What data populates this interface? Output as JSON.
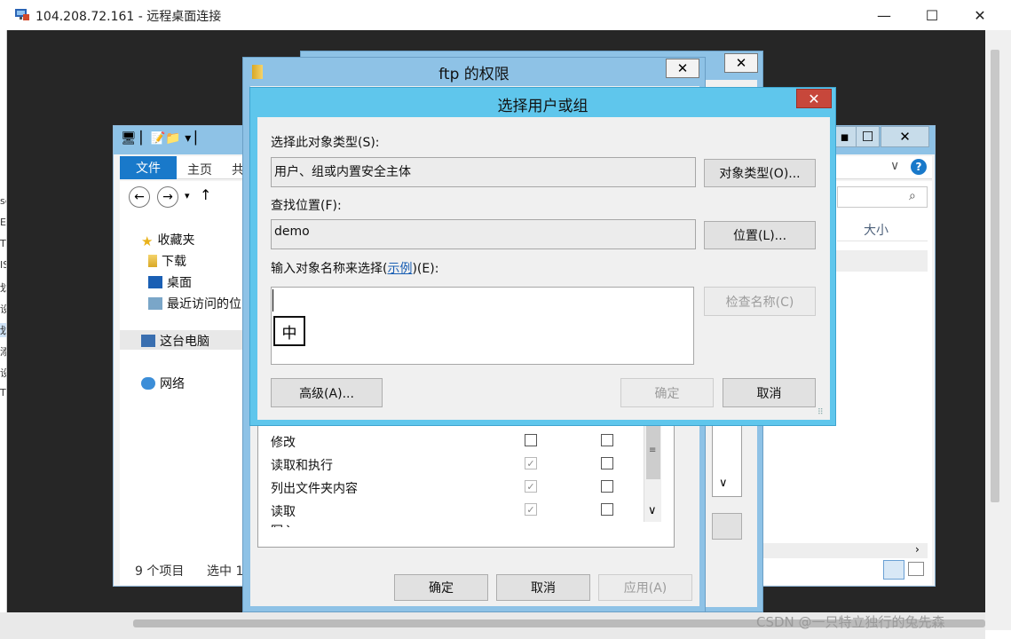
{
  "host": {
    "title": "104.208.72.161 - 远程桌面连接",
    "controls": [
      "—",
      "☐",
      "✕"
    ],
    "left_strip_chars": [
      "se",
      "E",
      "T",
      "IS",
      "划",
      "设",
      "划",
      "添",
      "设",
      "T"
    ],
    "watermark": "CSDN @一只特立独行的兔先森"
  },
  "explorer": {
    "ribbon_tabs": [
      "文件",
      "主页",
      "共"
    ],
    "nav_buttons": [
      "←",
      "→",
      "▾",
      "↑"
    ],
    "nav_items": [
      {
        "label": "收藏夹",
        "icon": "star-icon"
      },
      {
        "label": "下载",
        "icon": "download-folder-icon"
      },
      {
        "label": "桌面",
        "icon": "desktop-icon"
      },
      {
        "label": "最近访问的位",
        "icon": "recent-places-icon"
      },
      {
        "label": "这台电脑",
        "icon": "computer-icon"
      },
      {
        "label": "网络",
        "icon": "network-icon"
      }
    ],
    "column_size": "大小",
    "search_icon": "⌕",
    "help_icon": "?",
    "chevron": "∨",
    "status_count": "9 个项目",
    "status_selected": "选中 1",
    "window_controls": [
      "▪",
      "☐",
      "✕"
    ]
  },
  "ftp_dialog": {
    "title": "ftp 的权限",
    "close": "✕",
    "permissions": [
      {
        "name": "修改",
        "allow": false,
        "allow_disabled": false,
        "deny": false
      },
      {
        "name": "读取和执行",
        "allow": true,
        "allow_disabled": true,
        "deny": false
      },
      {
        "name": "列出文件夹内容",
        "allow": true,
        "allow_disabled": true,
        "deny": false
      },
      {
        "name": "读取",
        "allow": true,
        "allow_disabled": true,
        "deny": false
      },
      {
        "name": "写入",
        "allow": true,
        "allow_disabled": true,
        "deny": false
      }
    ],
    "ok": "确定",
    "cancel": "取消",
    "apply": "应用(A)"
  },
  "back_dialog": {
    "close": "✕"
  },
  "select_dialog": {
    "title": "选择用户或组",
    "close": "✕",
    "object_type_label": "选择此对象类型(S):",
    "object_type_value": "用户、组或内置安全主体",
    "object_type_button": "对象类型(O)...",
    "location_label": "查找位置(F):",
    "location_value": "demo",
    "location_button": "位置(L)...",
    "name_label_prefix": "输入对象名称来选择(",
    "name_label_link": "示例",
    "name_label_suffix": ")(E):",
    "name_input": "",
    "ime_indicator": "中",
    "check_names": "检查名称(C)",
    "advanced": "高级(A)...",
    "ok": "确定",
    "cancel": "取消",
    "grip": "⠿"
  }
}
